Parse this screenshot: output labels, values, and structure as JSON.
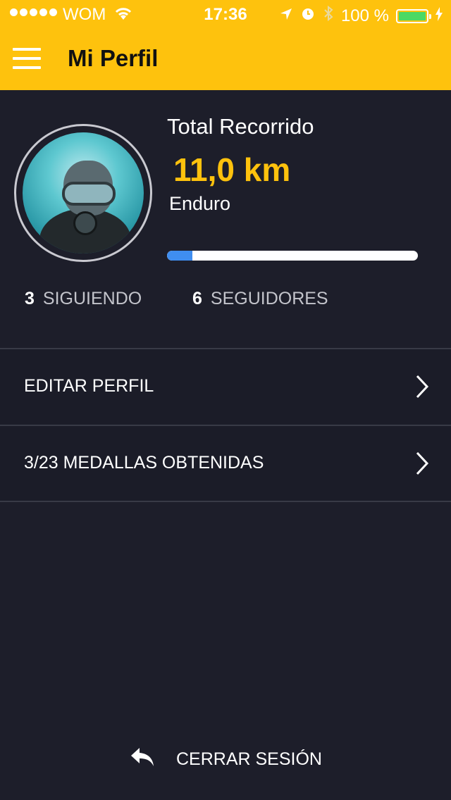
{
  "status_bar": {
    "carrier": "WOM",
    "time": "17:36",
    "battery": "100 %",
    "battery_level": 1.0
  },
  "nav": {
    "title": "Mi Perfil"
  },
  "profile": {
    "total_label": "Total Recorrido",
    "total_value": "11,0 km",
    "category": "Enduro",
    "progress": 0.1
  },
  "stats": {
    "following_count": "3",
    "following_label": "SIGUIENDO",
    "followers_count": "6",
    "followers_label": "SEGUIDORES"
  },
  "menu": {
    "items": [
      {
        "label": "EDITAR PERFIL"
      },
      {
        "label": "3/23 MEDALLAS OBTENIDAS"
      }
    ]
  },
  "logout": {
    "label": "CERRAR SESIÓN"
  },
  "colors": {
    "accent": "#fec20d",
    "background": "#1d1e2a",
    "progress": "#3f8ef0"
  }
}
